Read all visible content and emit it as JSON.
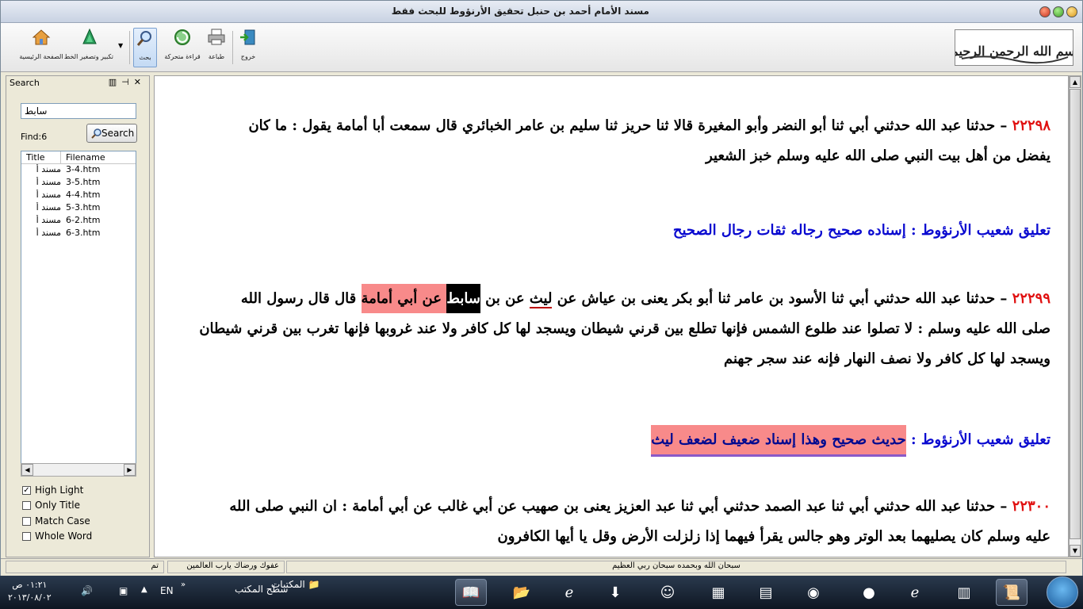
{
  "window": {
    "title": "مسند الأمام أحمد بن حنبل تحقيق الأرنؤوط للبحث فقط"
  },
  "toolbar": {
    "home": "الصفحة الرئيسية",
    "zoom": "تكبير وتصغير الخط",
    "search": "بحث",
    "animated_reading": "قراءة متحركة",
    "print": "طباعة",
    "exit": "خروج"
  },
  "basmala_text": "بسم الله الرحمن الرحيم",
  "search_panel": {
    "header": "Search",
    "query": "سابط",
    "find_label": "Find:6",
    "search_button": "Search",
    "columns": [
      "Title",
      "Filename"
    ],
    "results": [
      {
        "title": "مسند أ",
        "file": "3-4.htm"
      },
      {
        "title": "مسند أ",
        "file": "3-5.htm"
      },
      {
        "title": "مسند أ",
        "file": "4-4.htm"
      },
      {
        "title": "مسند أ",
        "file": "5-3.htm"
      },
      {
        "title": "مسند أ",
        "file": "6-2.htm"
      },
      {
        "title": "مسند أ",
        "file": "6-3.htm"
      }
    ],
    "options": [
      {
        "label": "High Light",
        "checked": true
      },
      {
        "label": "Only Title",
        "checked": false
      },
      {
        "label": "Match Case",
        "checked": false
      },
      {
        "label": "Whole Word",
        "checked": false
      }
    ]
  },
  "content": {
    "h1_num": "٢٢٢٩٨",
    "h1_line1": " – حدثنا عبد الله حدثني أبي ثنا أبو النضر وأبو المغيرة قالا ثنا حريز ثنا سليم بن عامر الخبائري قال سمعت أبا أمامة يقول : ما كان",
    "h1_line2": "يفضل من أهل بيت النبي صلى الله عليه وسلم خبز الشعير",
    "c1_label": "تعليق شعيب الأرنؤوط : ",
    "c1_text": "إسناده صحيح رجاله ثقات رجال الصحيح",
    "h2_num": "٢٢٢٩٩",
    "h2_part1": " – حدثنا عبد الله حدثني أبي ثنا الأسود بن عامر ثنا أبو بكر يعنى بن عياش عن ",
    "h2_laith": "ليث",
    "h2_part2": " عن بن ",
    "h2_sabit": "سابط",
    "h2_part3": " عن أبي أمامة",
    "h2_part4": " قال قال رسول الله",
    "h2_line2": "صلى الله عليه وسلم : لا تصلوا عند طلوع الشمس فإنها تطلع بين قرني شيطان ويسجد لها كل كافر ولا عند غروبها فإنها تغرب بين قرني شيطان",
    "h2_line3": "ويسجد لها كل كافر ولا نصف النهار فإنه عند سجر جهنم",
    "c2_label": "تعليق شعيب الأرنؤوط : ",
    "c2_text": "حديث صحيح وهذا إسناد ضعيف لضعف ليث",
    "h3_num": "٢٢٣٠٠",
    "h3_line1": " – حدثنا عبد الله حدثني أبي ثنا عبد الصمد حدثني أبي ثنا عبد العزيز يعنى بن صهيب عن أبي غالب عن أبي أمامة : ان النبي صلى الله",
    "h3_line2": "عليه وسلم كان يصليهما بعد الوتر وهو جالس يقرأ فيهما إذا زلزلت الأرض وقل يا أيها الكافرون"
  },
  "statusbar": {
    "left": "تم",
    "middle": "عفوك ورضاك يارب العالمين",
    "right": "سبحان الله وبحمده سبحان ربي العظيم"
  },
  "taskbar": {
    "time": "٠١:٢١ ص",
    "date": "٢٠١٣/٠٨/٠٢",
    "lang": "EN",
    "desktop": "سطح المكتب",
    "libraries": "المكتبات"
  }
}
